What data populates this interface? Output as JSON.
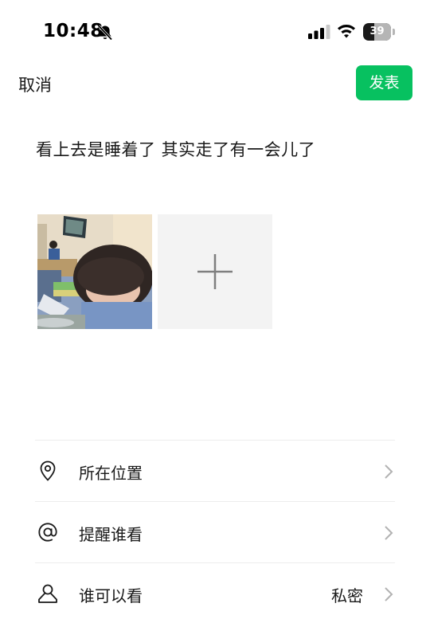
{
  "status_bar": {
    "time": "10:48",
    "battery_level": "39",
    "icons": [
      "bell-slash-icon",
      "cellular-signal-icon",
      "wifi-icon",
      "battery-icon"
    ]
  },
  "nav": {
    "cancel_label": "取消",
    "publish_label": "发表",
    "accent_color": "#07c160"
  },
  "post": {
    "text": "看上去是睡着了 其实走了有一会儿了",
    "photos": [
      {
        "name": "photo-person-sleeping-on-desk"
      }
    ],
    "add_photo_icon": "plus-icon"
  },
  "options": [
    {
      "label": "所在位置",
      "icon": "location-pin-icon",
      "value": ""
    },
    {
      "label": "提醒谁看",
      "icon": "at-sign-icon",
      "value": ""
    },
    {
      "label": "谁可以看",
      "icon": "person-icon",
      "value": "私密"
    }
  ]
}
